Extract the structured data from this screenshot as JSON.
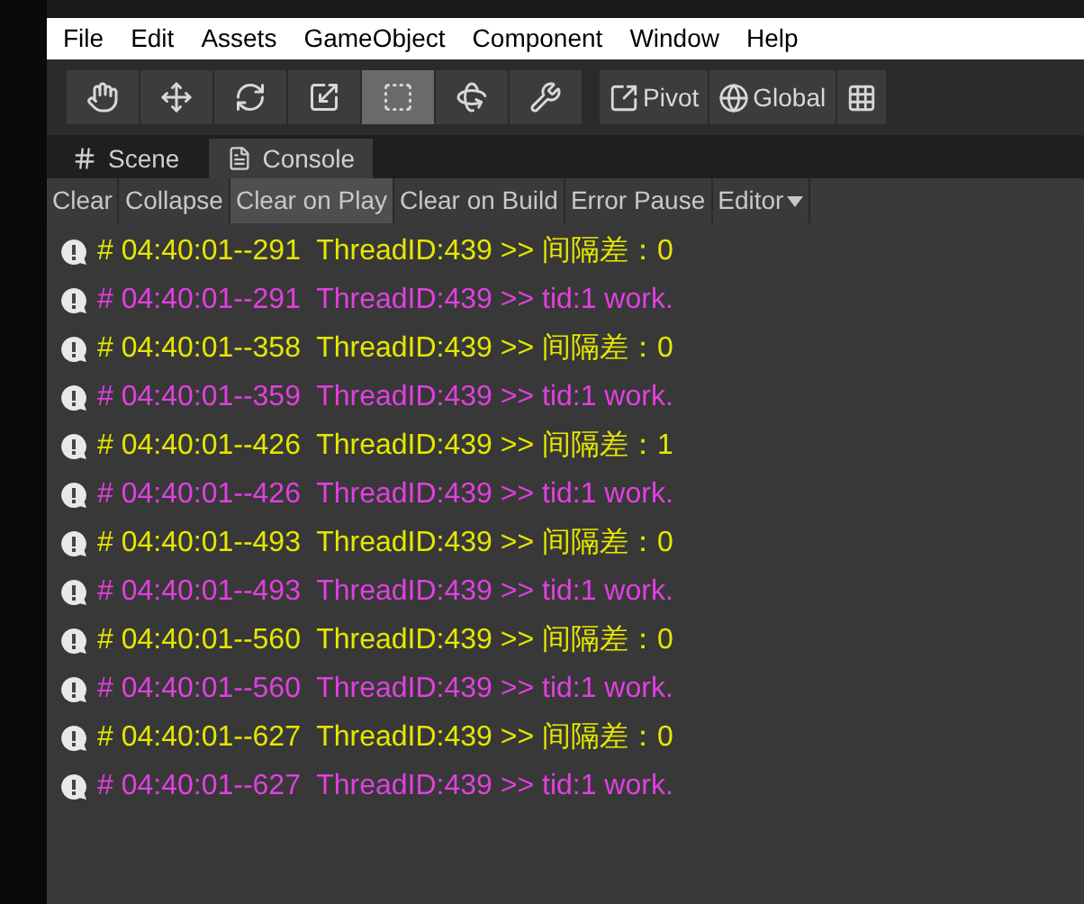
{
  "menu": [
    "File",
    "Edit",
    "Assets",
    "GameObject",
    "Component",
    "Window",
    "Help"
  ],
  "tools": [
    {
      "kind": "hand",
      "selected": false
    },
    {
      "kind": "move",
      "selected": false
    },
    {
      "kind": "rotate",
      "selected": false
    },
    {
      "kind": "scale",
      "selected": false
    },
    {
      "kind": "rect",
      "selected": true
    },
    {
      "kind": "transform",
      "selected": false
    },
    {
      "kind": "custom",
      "selected": false
    }
  ],
  "pivot_buttons": [
    {
      "kind": "pivot",
      "label": "Pivot"
    },
    {
      "kind": "global",
      "label": "Global"
    },
    {
      "kind": "snap"
    }
  ],
  "tabs": [
    {
      "kind": "scene",
      "label": "Scene",
      "selected": false
    },
    {
      "kind": "console",
      "label": "Console",
      "selected": true
    }
  ],
  "console_toolbar": [
    {
      "label": "Clear",
      "selected": false
    },
    {
      "label": "Collapse",
      "selected": false
    },
    {
      "label": "Clear on Play",
      "selected": true
    },
    {
      "label": "Clear on Build",
      "selected": false
    },
    {
      "label": "Error Pause",
      "selected": false
    },
    {
      "label": "Editor",
      "selected": false,
      "dropdown": true
    }
  ],
  "log": [
    {
      "text": "# 04:40:01--291  ThreadID:439 >> 间隔差：0",
      "color": "#e6e600"
    },
    {
      "text": "# 04:40:01--291  ThreadID:439 >> tid:1 work.",
      "color": "#e040e0"
    },
    {
      "text": "# 04:40:01--358  ThreadID:439 >> 间隔差：0",
      "color": "#e6e600"
    },
    {
      "text": "# 04:40:01--359  ThreadID:439 >> tid:1 work.",
      "color": "#e040e0"
    },
    {
      "text": "# 04:40:01--426  ThreadID:439 >> 间隔差：1",
      "color": "#e6e600"
    },
    {
      "text": "# 04:40:01--426  ThreadID:439 >> tid:1 work.",
      "color": "#e040e0"
    },
    {
      "text": "# 04:40:01--493  ThreadID:439 >> 间隔差：0",
      "color": "#e6e600"
    },
    {
      "text": "# 04:40:01--493  ThreadID:439 >> tid:1 work.",
      "color": "#e040e0"
    },
    {
      "text": "# 04:40:01--560  ThreadID:439 >> 间隔差：0",
      "color": "#e6e600"
    },
    {
      "text": "# 04:40:01--560  ThreadID:439 >> tid:1 work.",
      "color": "#e040e0"
    },
    {
      "text": "# 04:40:01--627  ThreadID:439 >> 间隔差：0",
      "color": "#e6e600"
    },
    {
      "text": "# 04:40:01--627  ThreadID:439 >> tid:1 work.",
      "color": "#e040e0"
    }
  ]
}
